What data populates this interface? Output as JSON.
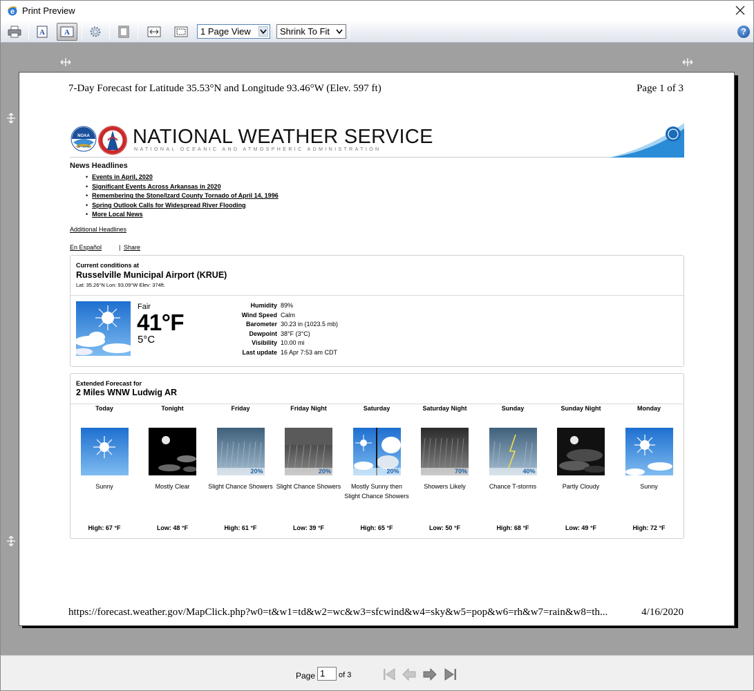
{
  "window": {
    "title": "Print Preview"
  },
  "toolbar": {
    "page_view": "1 Page View",
    "scale": "Shrink To Fit"
  },
  "page": {
    "header_left": "7-Day Forecast for Latitude 35.53°N and Longitude 93.46°W (Elev. 597 ft)",
    "header_right": "Page 1 of 3",
    "footer_left": "https://forecast.weather.gov/MapClick.php?w0=t&w1=td&w2=wc&w3=sfcwind&w4=sky&w5=pop&w6=rh&w7=rain&w8=th...",
    "footer_right": "4/16/2020"
  },
  "banner": {
    "title": "NATIONAL WEATHER SERVICE",
    "subtitle": "NATIONAL OCEANIC AND ATMOSPHERIC ADMINISTRATION",
    "noaa_text": "NOAA",
    "years_text": "50 YEARS"
  },
  "news": {
    "heading": "News Headlines",
    "items": [
      "Events in April, 2020",
      "Significant Events Across Arkansas in 2020",
      "Remembering the Stone/Izard County Tornado of April 14, 1996",
      "Spring Outlook Calls for Widespread River Flooding",
      "More Local News"
    ],
    "additional": "Additional Headlines",
    "espanol": "En Español",
    "share_sep": "|",
    "share": "Share"
  },
  "current": {
    "label": "Current conditions at",
    "station": "Russelville Municipal Airport (KRUE)",
    "coords": "Lat: 35.26°N  Lon: 93.09°W  Elev: 374ft.",
    "condition": "Fair",
    "temp_f": "41°F",
    "temp_c": "5°C",
    "details": [
      {
        "key": "Humidity",
        "value": "89%"
      },
      {
        "key": "Wind Speed",
        "value": "Calm"
      },
      {
        "key": "Barometer",
        "value": "30.23 in (1023.5 mb)"
      },
      {
        "key": "Dewpoint",
        "value": "38°F (3°C)"
      },
      {
        "key": "Visibility",
        "value": "10.00 mi"
      },
      {
        "key": "Last update",
        "value": "16 Apr 7:53 am CDT"
      }
    ]
  },
  "extended": {
    "label": "Extended Forecast for",
    "location": "2 Miles WNW Ludwig AR",
    "periods": [
      {
        "name": "Today",
        "icon": "sunny",
        "pop": "",
        "short": "Sunny",
        "temp": "High: 67 °F"
      },
      {
        "name": "Tonight",
        "icon": "mostly-clear-night",
        "pop": "",
        "short": "Mostly Clear",
        "temp": "Low: 48 °F"
      },
      {
        "name": "Friday",
        "icon": "showers",
        "pop": "20%",
        "short": "Slight Chance Showers",
        "temp": "High: 61 °F"
      },
      {
        "name": "Friday Night",
        "icon": "showers-night",
        "pop": "20%",
        "short": "Slight Chance Showers",
        "temp": "Low: 39 °F"
      },
      {
        "name": "Saturday",
        "icon": "sunny-then-showers",
        "pop": "20%",
        "short": "Mostly Sunny then Slight Chance Showers",
        "temp": "High: 65 °F"
      },
      {
        "name": "Saturday Night",
        "icon": "showers-likely-night",
        "pop": "70%",
        "short": "Showers Likely",
        "temp": "Low: 50 °F"
      },
      {
        "name": "Sunday",
        "icon": "thunderstorms",
        "pop": "40%",
        "short": "Chance T-storms",
        "temp": "High: 68 °F"
      },
      {
        "name": "Sunday Night",
        "icon": "partly-cloudy-night",
        "pop": "",
        "short": "Partly Cloudy",
        "temp": "Low: 49 °F"
      },
      {
        "name": "Monday",
        "icon": "sunny-clouds",
        "pop": "",
        "short": "Sunny",
        "temp": "High: 72 °F"
      }
    ]
  },
  "statusbar": {
    "page_label": "Page",
    "page_value": "1",
    "of_label": "of 3"
  }
}
